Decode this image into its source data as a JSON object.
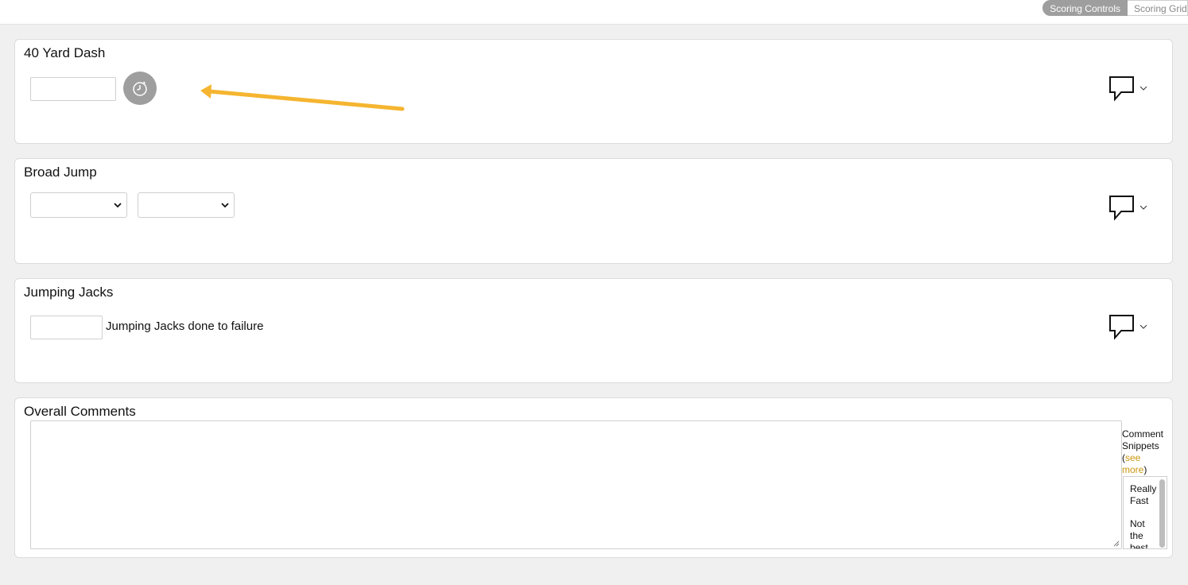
{
  "view_toggle": {
    "active_label": "Scoring Controls",
    "inactive_label": "Scoring Grid"
  },
  "cards": {
    "dash": {
      "title": "40 Yard Dash"
    },
    "broad": {
      "title": "Broad Jump"
    },
    "jacks": {
      "title": "Jumping Jacks",
      "input_label": "Jumping Jacks done to failure"
    },
    "overall": {
      "title": "Overall Comments"
    }
  },
  "snippets": {
    "heading_1": "Comment",
    "heading_2": "Snippets",
    "open_paren": "(",
    "see_more_1": "see",
    "see_more_2": "more",
    "close_paren": ")",
    "items": [
      "Really Fast",
      "Not the best at working"
    ]
  },
  "icons": {
    "timer": "stopwatch-icon",
    "comment": "comment-bubble-icon",
    "chevron": "chevron-down-icon"
  },
  "colors": {
    "accent_link": "#c8960c",
    "annotation_arrow": "#f5b530",
    "toggle_active": "#9e9e9e"
  }
}
